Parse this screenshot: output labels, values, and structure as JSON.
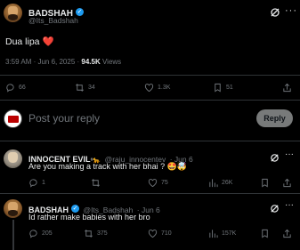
{
  "main_post": {
    "author_name": "BADSHAH",
    "author_handle": "@Its_Badshah",
    "text": "Dua lipa",
    "emoji": "❤️",
    "meta_time": "3:59 AM · Jun 6, 2025 · ",
    "views_count": "94.5K",
    "views_label": " Views",
    "stats": {
      "replies": "66",
      "reposts": "34",
      "likes": "1.3K",
      "bookmarks": "51"
    }
  },
  "composer": {
    "placeholder": "Post your reply",
    "reply_label": "Reply"
  },
  "replies": [
    {
      "author_name": "INNOCENT EVIL",
      "author_emoji": "⁶🐆",
      "author_handle": "@raju_innocentev",
      "time": "· Jun 6",
      "text": "Are you making a track with her bhai ? 🤩🤯",
      "stats": {
        "replies": "1",
        "reposts": "",
        "likes": "75",
        "views": "26K"
      }
    },
    {
      "author_name": "BADSHAH",
      "author_handle": "@Its_Badshah",
      "time": "· Jun 6",
      "text": "Id rather make babies with her bro",
      "stats": {
        "replies": "205",
        "reposts": "375",
        "likes": "710",
        "views": "157K"
      }
    }
  ],
  "colors": {
    "background": "#000000",
    "text": "#e7e9ea",
    "muted": "#71767b",
    "verified": "#1d9bf0",
    "divider": "#2f3336",
    "reply_button": "#787a7a",
    "heart": "#f91880"
  }
}
